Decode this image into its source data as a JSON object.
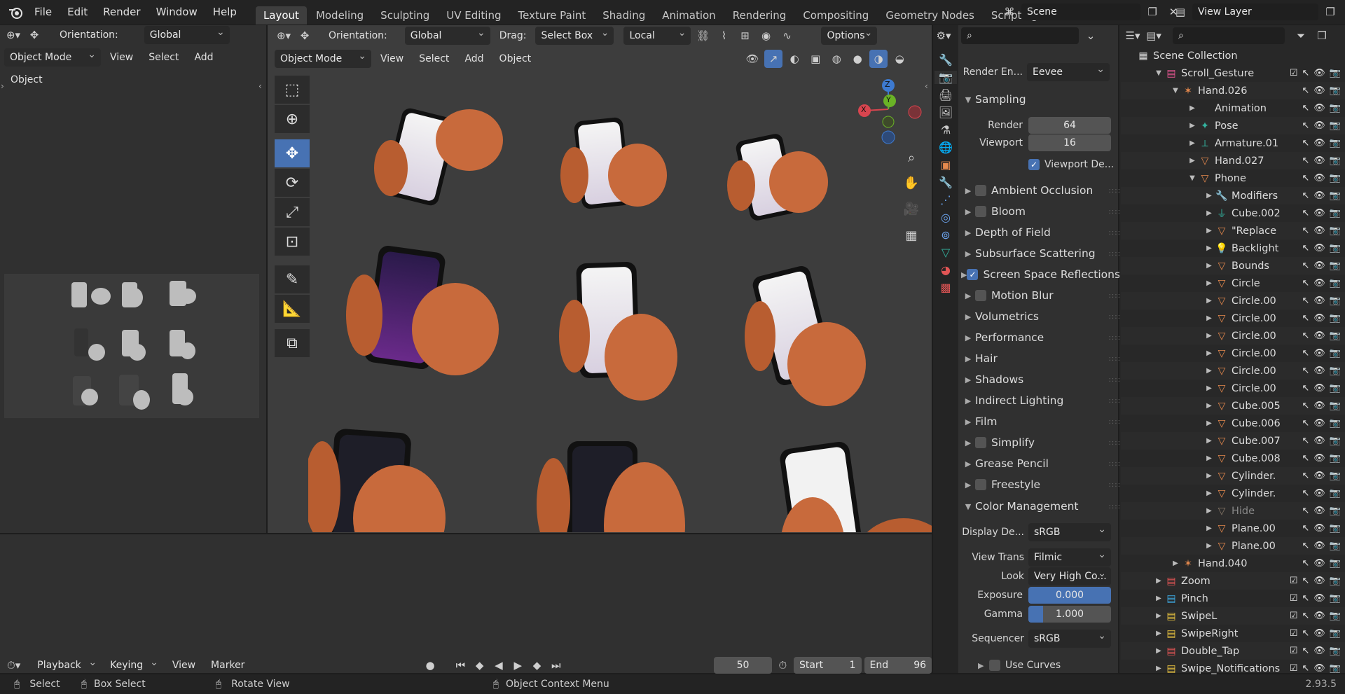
{
  "menus": [
    "File",
    "Edit",
    "Render",
    "Window",
    "Help"
  ],
  "workspaces": [
    "Layout",
    "Modeling",
    "Sculpting",
    "UV Editing",
    "Texture Paint",
    "Shading",
    "Animation",
    "Rendering",
    "Compositing",
    "Geometry Nodes",
    "Scripting"
  ],
  "active_workspace": "Layout",
  "scene": {
    "name": "Scene",
    "view_layer": "View Layer"
  },
  "left_header": {
    "orientation_label": "Orientation:",
    "orientation_value": "Global",
    "mode": "Object Mode",
    "menus": [
      "View",
      "Select",
      "Add",
      "Object"
    ]
  },
  "viewport_header": {
    "orientation_label": "Orientation:",
    "orientation_value": "Global",
    "drag_label": "Drag:",
    "drag_value": "Select Box",
    "pivot": "Local",
    "options": "Options",
    "mode": "Object Mode",
    "menus": [
      "View",
      "Select",
      "Add",
      "Object"
    ]
  },
  "gizmo": {
    "x": "X",
    "y": "Y",
    "z": "Z"
  },
  "properties": {
    "render_engine_label": "Render En...",
    "render_engine": "Eevee",
    "sampling": {
      "title": "Sampling",
      "render_label": "Render",
      "render_value": "64",
      "viewport_label": "Viewport",
      "viewport_value": "16",
      "denoise_label": "Viewport De...",
      "denoise_on": true
    },
    "panels": [
      {
        "label": "Ambient Occlusion",
        "checkbox": true,
        "checked": false
      },
      {
        "label": "Bloom",
        "checkbox": true,
        "checked": false
      },
      {
        "label": "Depth of Field",
        "checkbox": false
      },
      {
        "label": "Subsurface Scattering",
        "checkbox": false
      },
      {
        "label": "Screen Space Reflections",
        "checkbox": true,
        "checked": true
      },
      {
        "label": "Motion Blur",
        "checkbox": true,
        "checked": false
      },
      {
        "label": "Volumetrics",
        "checkbox": false
      },
      {
        "label": "Performance",
        "checkbox": false
      },
      {
        "label": "Hair",
        "checkbox": false
      },
      {
        "label": "Shadows",
        "checkbox": false
      },
      {
        "label": "Indirect Lighting",
        "checkbox": false
      },
      {
        "label": "Film",
        "checkbox": false
      },
      {
        "label": "Simplify",
        "checkbox": true,
        "checked": false
      },
      {
        "label": "Grease Pencil",
        "checkbox": false
      },
      {
        "label": "Freestyle",
        "checkbox": true,
        "checked": false
      }
    ],
    "color_management": {
      "title": "Color Management",
      "display_label": "Display De...",
      "display_value": "sRGB",
      "view_label": "View Trans",
      "view_value": "Filmic",
      "look_label": "Look",
      "look_value": "Very High Co...",
      "exposure_label": "Exposure",
      "exposure_value": "0.000",
      "gamma_label": "Gamma",
      "gamma_value": "1.000",
      "sequencer_label": "Sequencer",
      "sequencer_value": "sRGB",
      "curves_label": "Use Curves"
    }
  },
  "outliner": {
    "root": "Scene Collection",
    "items": [
      {
        "label": "Scroll_Gesture",
        "icon": "collection-icon",
        "color": "#e25590",
        "indent": 1
      },
      {
        "label": "Hand.026",
        "icon": "armature-icon",
        "color": "#e5894d",
        "indent": 2
      },
      {
        "label": "Animation",
        "icon": "none",
        "color": "#dcdcdc",
        "indent": 3
      },
      {
        "label": "Pose",
        "icon": "pose-icon",
        "color": "#33b4a0",
        "indent": 3
      },
      {
        "label": "Armature.01",
        "icon": "armature-data-icon",
        "color": "#33b4a0",
        "indent": 3
      },
      {
        "label": "Hand.027",
        "icon": "mesh-icon",
        "color": "#e5894d",
        "indent": 3
      },
      {
        "label": "Phone",
        "icon": "mesh-icon",
        "color": "#e5894d",
        "indent": 3
      },
      {
        "label": "Modifiers",
        "icon": "wrench-icon",
        "color": "#6aa0e8",
        "indent": 4
      },
      {
        "label": "Cube.002",
        "icon": "mesh-data-icon",
        "color": "#33b4a0",
        "indent": 4
      },
      {
        "label": "\"Replace",
        "icon": "mesh-icon",
        "color": "#e5894d",
        "indent": 4
      },
      {
        "label": "Backlight",
        "icon": "light-icon",
        "color": "#e5894d",
        "indent": 4
      },
      {
        "label": "Bounds",
        "icon": "mesh-icon",
        "color": "#e5894d",
        "indent": 4
      },
      {
        "label": "Circle",
        "icon": "mesh-icon",
        "color": "#e5894d",
        "indent": 4
      },
      {
        "label": "Circle.00",
        "icon": "mesh-icon",
        "color": "#e5894d",
        "indent": 4
      },
      {
        "label": "Circle.00",
        "icon": "mesh-icon",
        "color": "#e5894d",
        "indent": 4
      },
      {
        "label": "Circle.00",
        "icon": "mesh-icon",
        "color": "#e5894d",
        "indent": 4
      },
      {
        "label": "Circle.00",
        "icon": "mesh-icon",
        "color": "#e5894d",
        "indent": 4
      },
      {
        "label": "Circle.00",
        "icon": "mesh-icon",
        "color": "#e5894d",
        "indent": 4
      },
      {
        "label": "Circle.00",
        "icon": "mesh-icon",
        "color": "#e5894d",
        "indent": 4
      },
      {
        "label": "Cube.005",
        "icon": "mesh-icon",
        "color": "#e5894d",
        "indent": 4
      },
      {
        "label": "Cube.006",
        "icon": "mesh-icon",
        "color": "#e5894d",
        "indent": 4
      },
      {
        "label": "Cube.007",
        "icon": "mesh-icon",
        "color": "#e5894d",
        "indent": 4
      },
      {
        "label": "Cube.008",
        "icon": "mesh-icon",
        "color": "#e5894d",
        "indent": 4
      },
      {
        "label": "Cylinder.",
        "icon": "mesh-icon",
        "color": "#e5894d",
        "indent": 4
      },
      {
        "label": "Cylinder.",
        "icon": "mesh-icon",
        "color": "#e5894d",
        "indent": 4
      },
      {
        "label": "Hide",
        "icon": "mesh-icon",
        "color": "#8a7a6a",
        "indent": 4
      },
      {
        "label": "Plane.00",
        "icon": "mesh-icon",
        "color": "#e5894d",
        "indent": 4
      },
      {
        "label": "Plane.00",
        "icon": "mesh-icon",
        "color": "#e5894d",
        "indent": 4
      },
      {
        "label": "Hand.040",
        "icon": "armature-icon",
        "color": "#e5894d",
        "indent": 2
      },
      {
        "label": "Zoom",
        "icon": "collection-icon",
        "color": "#e25555",
        "indent": 1
      },
      {
        "label": "Pinch",
        "icon": "collection-icon",
        "color": "#3da9e0",
        "indent": 1
      },
      {
        "label": "SwipeL",
        "icon": "collection-icon",
        "color": "#e5c040",
        "indent": 1
      },
      {
        "label": "SwipeRight",
        "icon": "collection-icon",
        "color": "#e5c040",
        "indent": 1
      },
      {
        "label": "Double_Tap",
        "icon": "collection-icon",
        "color": "#e25555",
        "indent": 1
      },
      {
        "label": "Swipe_Notifications",
        "icon": "collection-icon",
        "color": "#e5c040",
        "indent": 1
      }
    ]
  },
  "timeline": {
    "menus": [
      "Playback",
      "Keying",
      "View",
      "Marker"
    ],
    "current_frame": "50",
    "start_label": "Start",
    "start": "1",
    "end_label": "End",
    "end": "96"
  },
  "statusbar": {
    "select": "Select",
    "box_select": "Box Select",
    "rotate": "Rotate View",
    "context": "Object Context Menu",
    "version": "2.93.5"
  },
  "colors": {
    "accent": "#4772b3",
    "bg": "#1d1d1d",
    "panel": "#303030",
    "viewport": "#3d3d3d",
    "hand": "#c86a3c"
  }
}
